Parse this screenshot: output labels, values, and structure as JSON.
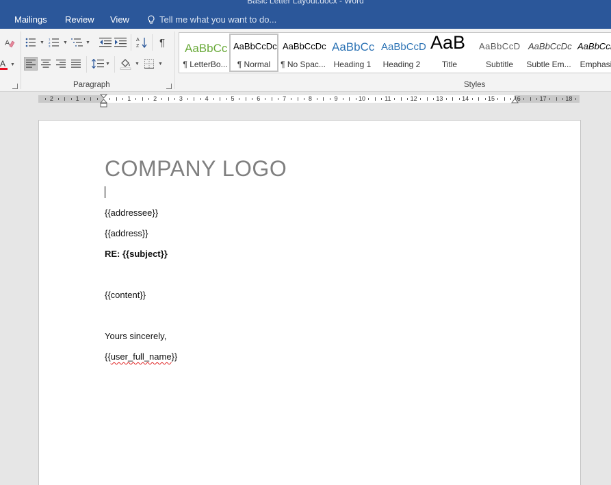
{
  "window": {
    "title": "Basic Letter Layout.docx - Word"
  },
  "tabs": [
    {
      "label": "Mailings"
    },
    {
      "label": "Review"
    },
    {
      "label": "View"
    }
  ],
  "tell_me": {
    "placeholder": "Tell me what you want to do..."
  },
  "ribbon": {
    "paragraph_group_label": "Paragraph",
    "styles_group_label": "Styles",
    "font_color": "#e81123",
    "accent": "#2b579a",
    "styles": [
      {
        "sample": "AaBbCc",
        "name": "¶ LetterBo...",
        "sample_color": "#6aaa3a",
        "selected": false
      },
      {
        "sample": "AaBbCcDc",
        "name": "¶ Normal",
        "sample_color": "#000000",
        "selected": true
      },
      {
        "sample": "AaBbCcDc",
        "name": "¶ No Spac...",
        "sample_color": "#000000",
        "selected": false
      },
      {
        "sample": "AaBbCc",
        "name": "Heading 1",
        "sample_color": "#2e74b5",
        "selected": false
      },
      {
        "sample": "AaBbCcD",
        "name": "Heading 2",
        "sample_color": "#2e74b5",
        "selected": false
      },
      {
        "sample": "AaB",
        "name": "Title",
        "sample_color": "#000000",
        "selected": false
      },
      {
        "sample": "AaBbCcD",
        "name": "Subtitle",
        "sample_color": "#5a5a5a",
        "selected": false
      },
      {
        "sample": "AaBbCcDc",
        "name": "Subtle Em...",
        "sample_color": "#404040",
        "selected": false
      },
      {
        "sample": "AaBbCcDc",
        "name": "Emphasis",
        "sample_color": "#000000",
        "selected": false
      }
    ]
  },
  "ruler": {
    "numbers": [
      "2",
      "1",
      "1",
      "2",
      "3",
      "4",
      "5",
      "6",
      "7",
      "8",
      "9",
      "10",
      "11",
      "12",
      "13",
      "14",
      "15",
      "16",
      "17",
      "18"
    ]
  },
  "document": {
    "logo": "COMPANY LOGO",
    "addressee": "{{addressee}}",
    "address": "{{address}}",
    "subject": "RE: {{subject}}",
    "content": "{{content}}",
    "closing": "Yours sincerely,",
    "signature_open": "{{",
    "signature_name": "user_full_name",
    "signature_close": "}}"
  }
}
